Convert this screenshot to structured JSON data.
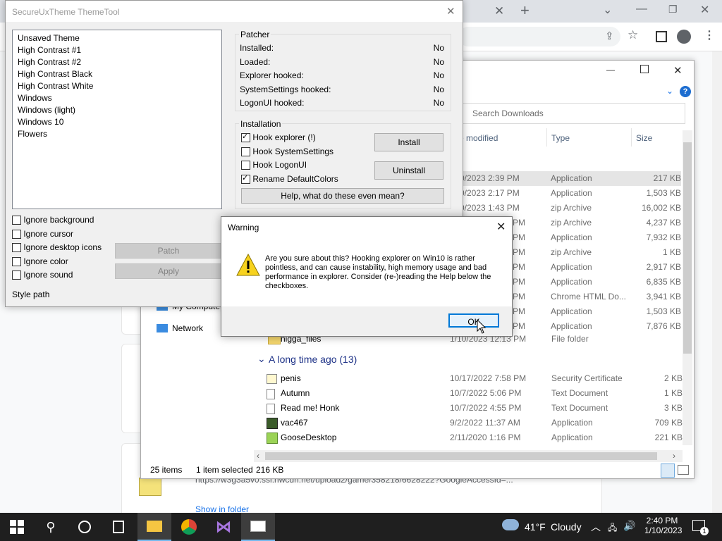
{
  "chrome": {
    "new_tab_label": "+",
    "download_url": "https://w3g3a5v0.ssl.hwcdn.net/upload2/game/358218/6628222?GoogleAccessId=...",
    "show_in_folder": "Show in folder"
  },
  "explorer": {
    "search_placeholder": "Search Downloads",
    "columns": {
      "date": "e modified",
      "type": "Type",
      "size": "Size"
    },
    "nav_my_computer": "My Compute",
    "nav_network": "Network",
    "rows_top": [
      {
        "date": "0/2023 2:39 PM",
        "type": "Application",
        "size": "217 KB"
      },
      {
        "date": "0/2023 2:17 PM",
        "type": "Application",
        "size": "1,503 KB"
      },
      {
        "date": "0/2023 1:43 PM",
        "type": "zip Archive",
        "size": "16,002 KB"
      },
      {
        "date": "PM",
        "type": "zip Archive",
        "size": "4,237 KB"
      },
      {
        "date": "PM",
        "type": "Application",
        "size": "7,932 KB"
      },
      {
        "date": "PM",
        "type": "zip Archive",
        "size": "1 KB"
      },
      {
        "date": "PM",
        "type": "Application",
        "size": "2,917 KB"
      },
      {
        "date": "PM",
        "type": "Application",
        "size": "6,835 KB"
      },
      {
        "date": "PM",
        "type": "Chrome HTML Do...",
        "size": "3,941 KB"
      },
      {
        "date": "PM",
        "type": "Application",
        "size": "1,503 KB"
      },
      {
        "date": "PM",
        "type": "Application",
        "size": "7,876 KB"
      }
    ],
    "folder_row": {
      "name": "nigga_files",
      "date": "1/10/2023 12:13 PM",
      "type": "File folder",
      "size": ""
    },
    "group_header": "A long time ago (13)",
    "rows_bottom": [
      {
        "name": "penis",
        "date": "10/17/2022 7:58 PM",
        "type": "Security Certificate",
        "size": "2 KB"
      },
      {
        "name": "Autumn",
        "date": "10/7/2022 5:06 PM",
        "type": "Text Document",
        "size": "1 KB"
      },
      {
        "name": "Read me! Honk",
        "date": "10/7/2022 4:55 PM",
        "type": "Text Document",
        "size": "3 KB"
      },
      {
        "name": "vac467",
        "date": "9/2/2022 11:37 AM",
        "type": "Application",
        "size": "709 KB"
      },
      {
        "name": "GooseDesktop",
        "date": "2/11/2020 1:16 PM",
        "type": "Application",
        "size": "221 KB"
      }
    ],
    "status": {
      "items": "25 items",
      "selected": "1 item selected",
      "size": "216 KB"
    }
  },
  "themetool": {
    "title": "SecureUxTheme ThemeTool",
    "themes": [
      "Unsaved Theme",
      "High Contrast #1",
      "High Contrast #2",
      "High Contrast Black",
      "High Contrast White",
      "Windows",
      "Windows (light)",
      "Windows 10",
      "Flowers"
    ],
    "patcher": {
      "title": "Patcher",
      "rows": [
        {
          "label": "Installed:",
          "value": "No"
        },
        {
          "label": "Loaded:",
          "value": "No"
        },
        {
          "label": "Explorer hooked:",
          "value": "No"
        },
        {
          "label": "SystemSettings hooked:",
          "value": "No"
        },
        {
          "label": "LogonUI hooked:",
          "value": "No"
        }
      ]
    },
    "installation": {
      "title": "Installation",
      "hook_explorer": "Hook explorer (!)",
      "hook_systemsettings": "Hook SystemSettings",
      "hook_logonui": "Hook LogonUI",
      "rename_defaultcolors": "Rename DefaultColors",
      "install": "Install",
      "uninstall": "Uninstall",
      "help": "Help, what do these even mean?"
    },
    "options": {
      "ignore_background": "Ignore background",
      "ignore_cursor": "Ignore cursor",
      "ignore_desktop_icons": "Ignore desktop icons",
      "ignore_color": "Ignore color",
      "ignore_sound": "Ignore sound"
    },
    "patch": "Patch",
    "apply": "Apply",
    "style_path": "Style path"
  },
  "warning": {
    "title": "Warning",
    "message": "Are you sure about this? Hooking explorer on Win10 is rather pointless, and can cause instability, high memory usage and bad performance in explorer. Consider (re-)reading the Help below the checkboxes.",
    "ok": "OK"
  },
  "taskbar": {
    "weather_temp": "41°F",
    "weather_cond": "Cloudy",
    "time": "2:40 PM",
    "date": "1/10/2023",
    "notif_count": "1"
  }
}
